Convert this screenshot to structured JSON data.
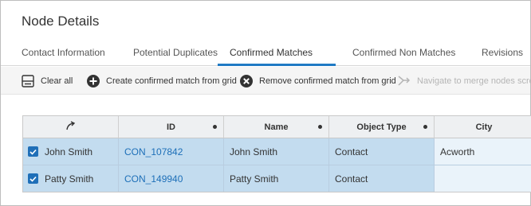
{
  "page": {
    "title": "Node Details"
  },
  "tabs": [
    {
      "label": "Contact Information",
      "active": false
    },
    {
      "label": "Potential Duplicates",
      "active": false
    },
    {
      "label": "Confirmed Matches",
      "active": true
    },
    {
      "label": "Confirmed Non Matches",
      "active": false
    },
    {
      "label": "Revisions",
      "active": false
    }
  ],
  "toolbar": {
    "clear_all": "Clear all",
    "create": "Create confirmed match from grid",
    "remove": "Remove confirmed match from grid",
    "navigate": "Navigate to merge nodes screen"
  },
  "grid": {
    "columns": [
      "ID",
      "Name",
      "Object Type",
      "City"
    ],
    "rows": [
      {
        "checked": true,
        "label": "John Smith",
        "id": "CON_107842",
        "name": "John Smith",
        "object_type": "Contact",
        "city": "Acworth"
      },
      {
        "checked": true,
        "label": "Patty Smith",
        "id": "CON_149940",
        "name": "Patty Smith",
        "object_type": "Contact",
        "city": ""
      }
    ]
  },
  "colors": {
    "accent": "#1f7ac4",
    "selected_row": "#c3dcef",
    "link": "#1d6fb8"
  }
}
